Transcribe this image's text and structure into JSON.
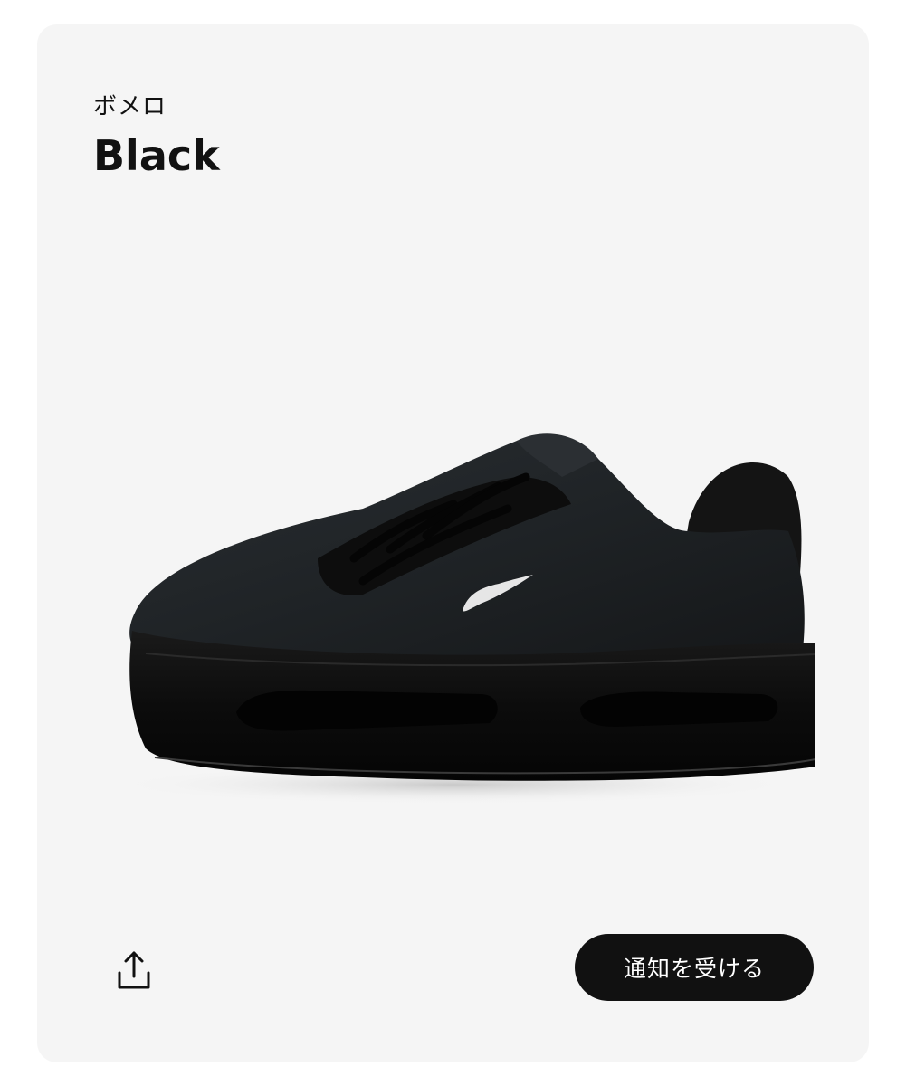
{
  "product": {
    "category_label": "ボメロ",
    "color_name": "Black",
    "image_icon": "sneaker-image"
  },
  "actions": {
    "share_icon": "share-icon",
    "notify_label": "通知を受ける"
  },
  "colors": {
    "card_background": "#f5f5f5",
    "button_background": "#111111",
    "button_text": "#ffffff",
    "text_primary": "#111111"
  }
}
